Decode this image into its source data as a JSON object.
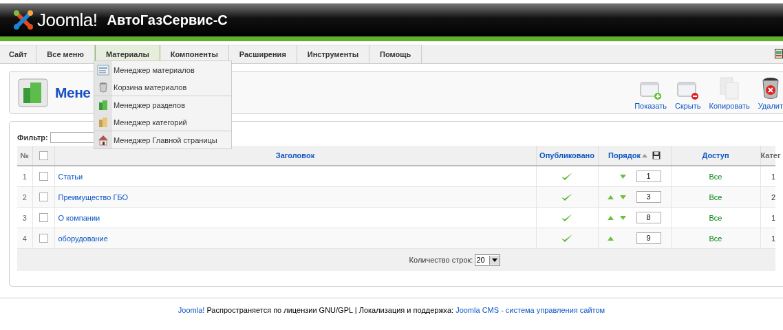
{
  "header": {
    "logo_text": "Joomla!",
    "site_name": "АвтоГазСервис-С"
  },
  "menu": [
    {
      "label": "Сайт",
      "selected": false
    },
    {
      "label": "Все меню",
      "selected": false
    },
    {
      "label": "Материалы",
      "selected": true
    },
    {
      "label": "Компоненты",
      "selected": false
    },
    {
      "label": "Расширения",
      "selected": false
    },
    {
      "label": "Инструменты",
      "selected": false
    },
    {
      "label": "Помощь",
      "selected": false
    }
  ],
  "dropdown": {
    "groups": [
      [
        {
          "label": "Менеджер материалов",
          "kind": "articles"
        },
        {
          "label": "Корзина материалов",
          "kind": "trash"
        }
      ],
      [
        {
          "label": "Менеджер разделов",
          "kind": "sections"
        },
        {
          "label": "Менеджер категорий",
          "kind": "categories"
        }
      ],
      [
        {
          "label": "Менеджер Главной страницы",
          "kind": "frontpage"
        }
      ]
    ]
  },
  "toolbar": {
    "title": "Мене",
    "buttons": [
      {
        "label": "Показать",
        "kind": "publish"
      },
      {
        "label": "Скрыть",
        "kind": "unpublish"
      },
      {
        "label": "Копировать",
        "kind": "copy"
      },
      {
        "label": "Удалит",
        "kind": "delete"
      }
    ]
  },
  "filter": {
    "label": "Фильтр:"
  },
  "table": {
    "columns": [
      "№",
      "Заголовок",
      "Опубликовано",
      "Порядок",
      "Доступ",
      "Катег"
    ],
    "select_all_checked": false,
    "rows": [
      {
        "num": "1",
        "checked": false,
        "title": "Статьи",
        "published": true,
        "can_move_up": false,
        "can_move_down": true,
        "order": "1",
        "access": "Все",
        "column_7": "1"
      },
      {
        "num": "2",
        "checked": false,
        "title": "Преимущество ГБО",
        "published": true,
        "can_move_up": true,
        "can_move_down": true,
        "order": "3",
        "access": "Все",
        "column_7": "2"
      },
      {
        "num": "3",
        "checked": false,
        "title": "О компании",
        "published": true,
        "can_move_up": true,
        "can_move_down": true,
        "order": "8",
        "access": "Все",
        "column_7": "1"
      },
      {
        "num": "4",
        "checked": false,
        "title": "оборудование",
        "published": true,
        "can_move_up": true,
        "can_move_down": false,
        "order": "9",
        "access": "Все",
        "column_7": "1"
      }
    ],
    "pagination": {
      "label": "Количество строк:",
      "value": "20"
    }
  },
  "footer": {
    "link_1": "Joomla!",
    "text": " Распространяется по лицензии GNU/GPL | Локализация и поддержка: ",
    "link_2": "Joomla CMS - система управления сайтом"
  }
}
